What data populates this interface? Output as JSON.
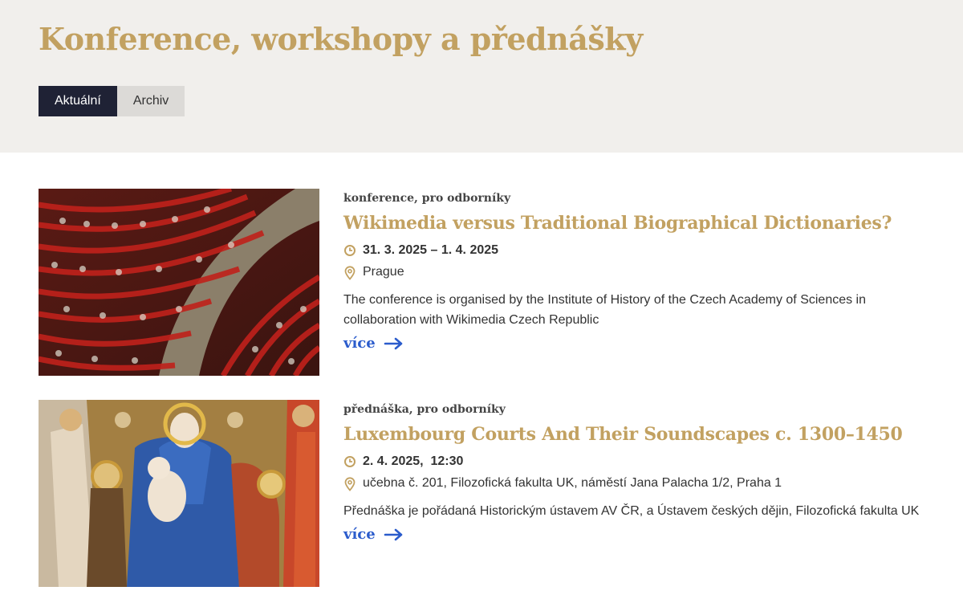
{
  "header": {
    "title": "Konference, workshopy a přednášky",
    "tabs": [
      {
        "label": "Aktuální",
        "active": true
      },
      {
        "label": "Archiv",
        "active": false
      }
    ]
  },
  "events": [
    {
      "image": "conference-auditorium-photo",
      "tags": "konference, pro odborníky",
      "title": "Wikimedia versus Traditional Biographical Dictionaries?",
      "date": "31. 3. 2025 – 1. 4. 2025",
      "place": "Prague",
      "description": "The conference is organised by the Institute of History of the Czech Academy of Sciences in collaboration with Wikimedia Czech Republic",
      "more_label": "více"
    },
    {
      "image": "medieval-madonna-painting",
      "tags": "přednáška, pro odborníky",
      "title": "Luxembourg Courts And Their Soundscapes c. 1300–1450",
      "date": "2. 4. 2025,  12:30",
      "place": "učebna č. 201, Filozofická fakulta UK, náměstí Jana Palacha 1/2, Praha 1",
      "description": "Přednáška je pořádaná Historickým ústavem AV ČR, a Ústavem českých dějin, Filozofická fakulta UK",
      "more_label": "více"
    }
  ],
  "colors": {
    "accent_gold": "#c2a161",
    "tab_active": "#1f2235",
    "link_blue": "#2b5ccc",
    "hero_bg": "#f1efec"
  }
}
